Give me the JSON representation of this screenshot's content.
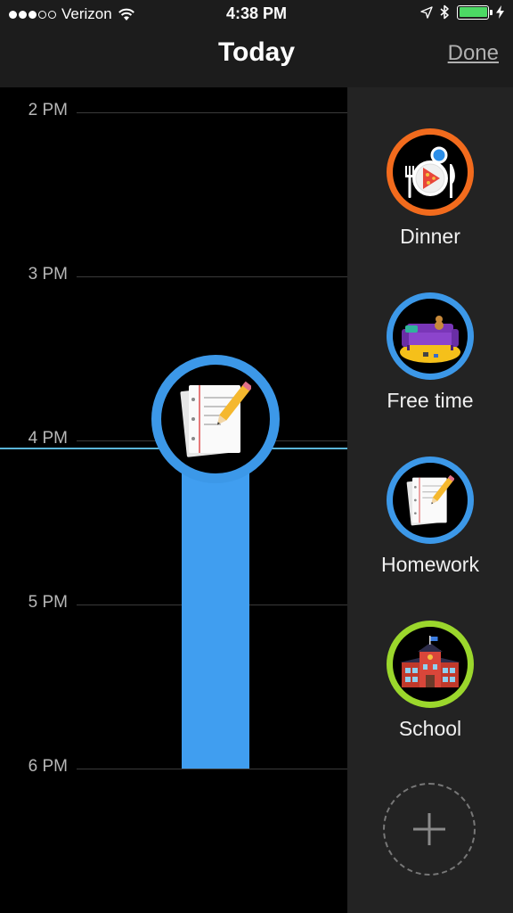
{
  "status_bar": {
    "carrier": "Verizon",
    "time": "4:38 PM",
    "signal_bars_filled": 3,
    "signal_bars_total": 5,
    "battery_level": 1.0,
    "icons": [
      "wifi-icon",
      "location-arrow-icon",
      "bluetooth-icon",
      "battery-icon",
      "charging-bolt-icon"
    ]
  },
  "nav": {
    "title": "Today",
    "done_label": "Done"
  },
  "timeline": {
    "hours": [
      {
        "label": "2 PM"
      },
      {
        "label": "3 PM"
      },
      {
        "label": "4 PM"
      },
      {
        "label": "5 PM"
      },
      {
        "label": "6 PM"
      }
    ],
    "event": {
      "activity": "Homework",
      "start": "4 PM",
      "end": "6 PM",
      "color": "#409ef0",
      "icon": "homework-notebook-icon"
    },
    "now_indicator_time": "4:38 PM",
    "now_color": "#5ab4d8"
  },
  "activities": [
    {
      "label": "Dinner",
      "ring_color": "#f26b1d",
      "icon": "dinner-plate-icon"
    },
    {
      "label": "Free time",
      "ring_color": "#3c98e8",
      "icon": "couch-icon"
    },
    {
      "label": "Homework",
      "ring_color": "#3c98e8",
      "icon": "homework-notebook-icon"
    },
    {
      "label": "School",
      "ring_color": "#9bd72c",
      "icon": "school-building-icon"
    }
  ],
  "add_button": {
    "icon": "plus-icon"
  }
}
